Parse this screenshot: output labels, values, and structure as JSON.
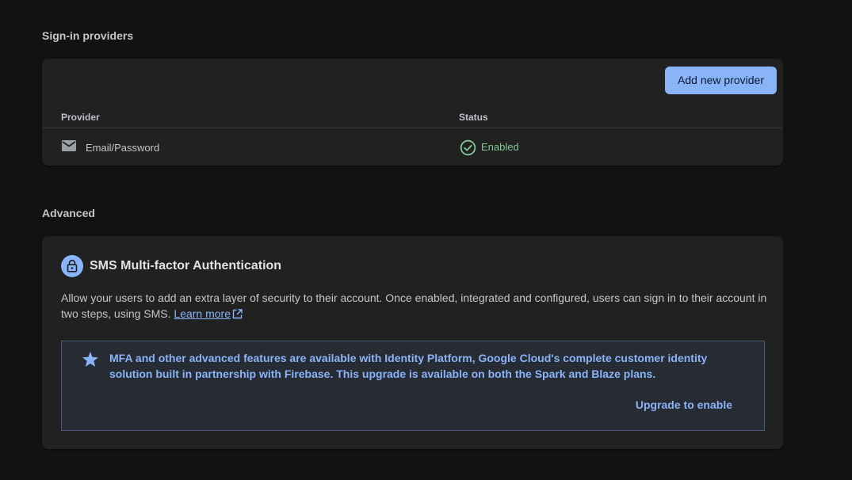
{
  "signin": {
    "section_title": "Sign-in providers",
    "add_button_label": "Add new provider",
    "columns": {
      "provider": "Provider",
      "status": "Status"
    },
    "rows": [
      {
        "provider": "Email/Password",
        "provider_icon": "mail-icon",
        "status": "Enabled",
        "status_icon": "check-circle-icon"
      }
    ]
  },
  "advanced": {
    "section_title": "Advanced",
    "mfa": {
      "icon": "lock-icon",
      "title": "SMS Multi-factor Authentication",
      "description": "Allow your users to add an extra layer of security to their account. Once enabled, integrated and configured, users can sign in to their account in two steps, using SMS.",
      "learn_more_label": "Learn more",
      "info_icon": "star-icon",
      "info_text": "MFA and other advanced features are available with Identity Platform, Google Cloud's complete customer identity solution built in partnership with Firebase. This upgrade is available on both the Spark and Blaze plans.",
      "upgrade_label": "Upgrade to enable"
    }
  },
  "colors": {
    "background": "#121212",
    "card": "#212121",
    "accent": "#8ab4f8",
    "success": "#81c995"
  }
}
